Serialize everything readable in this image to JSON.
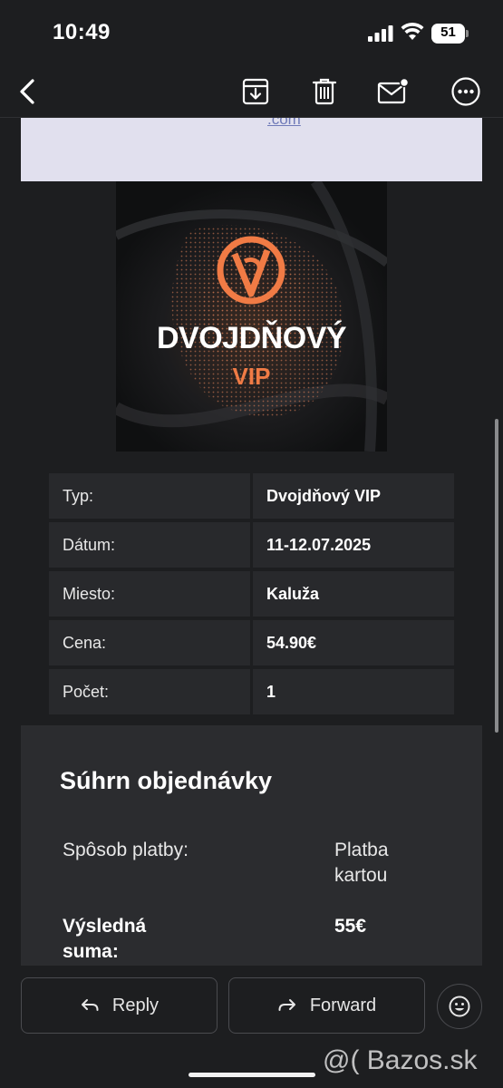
{
  "status_bar": {
    "time": "10:49",
    "battery": "51"
  },
  "toolbar": {
    "back_icon": "chevron-left-icon",
    "archive_icon": "archive-icon",
    "delete_icon": "trash-icon",
    "mark_unread_icon": "mail-unread-icon",
    "more_icon": "more-icon"
  },
  "email": {
    "top_link": ".com",
    "hero": {
      "title": "DVOJDŇOVÝ",
      "subtitle": "VIP",
      "accent_color": "#f07b45"
    },
    "details": [
      {
        "label": "Typ:",
        "value": "Dvojdňový VIP"
      },
      {
        "label": "Dátum:",
        "value": "11-12.07.2025"
      },
      {
        "label": "Miesto:",
        "value": "Kaluža"
      },
      {
        "label": "Cena:",
        "value": "54.90€"
      },
      {
        "label": "Počet:",
        "value": "1"
      }
    ],
    "summary": {
      "title": "Súhrn objednávky",
      "payment_label": "Spôsob platby:",
      "payment_value": "Platba kartou",
      "total_label": "Výsledná suma:",
      "total_value": "55€"
    }
  },
  "actions": {
    "reply": "Reply",
    "forward": "Forward",
    "emoji_icon": "emoji-reaction-icon"
  },
  "watermark": "@( Bazos.sk"
}
